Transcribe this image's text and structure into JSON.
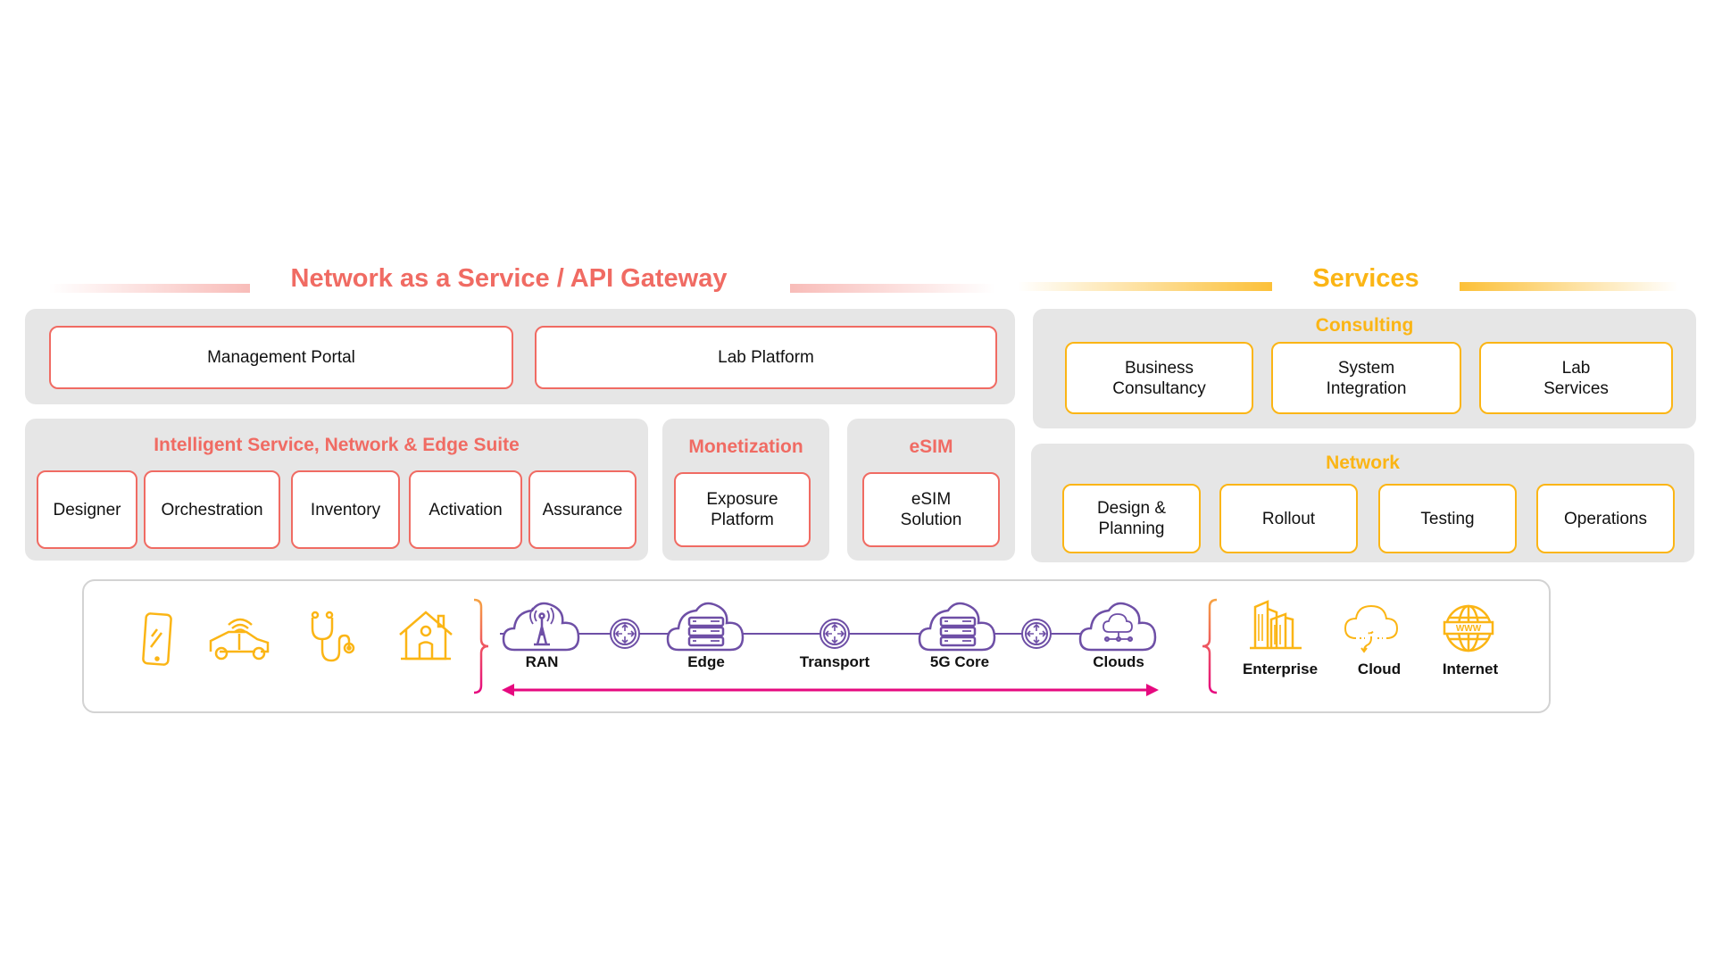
{
  "colors": {
    "red": "#f06b63",
    "yellow": "#fbb515",
    "purple": "#6e4fa6",
    "magenta": "#e6097f",
    "panel": "#e6e6e6"
  },
  "naas": {
    "title": "Network as a Service / API Gateway",
    "top_boxes": [
      "Management Portal",
      "Lab Platform"
    ],
    "isne": {
      "title": "Intelligent Service, Network & Edge Suite",
      "items": [
        "Designer",
        "Orchestration",
        "Inventory",
        "Activation",
        "Assurance"
      ]
    },
    "monetization": {
      "title": "Monetization",
      "item": "Exposure Platform"
    },
    "esim": {
      "title": "eSIM",
      "item": "eSIM Solution"
    }
  },
  "services": {
    "title": "Services",
    "consulting": {
      "title": "Consulting",
      "items": [
        "Business Consultancy",
        "System Integration",
        "Lab Services"
      ]
    },
    "network": {
      "title": "Network",
      "items": [
        "Design & Planning",
        "Rollout",
        "Testing",
        "Operations"
      ]
    }
  },
  "flow": {
    "devices": [
      {
        "icon": "smartphone-icon"
      },
      {
        "icon": "connected-car-icon"
      },
      {
        "icon": "stethoscope-icon"
      },
      {
        "icon": "smart-home-icon"
      }
    ],
    "nodes": [
      {
        "label": "RAN",
        "icon": "cell-tower-cloud-icon"
      },
      {
        "label": "Edge",
        "icon": "server-cloud-icon"
      },
      {
        "label": "Transport",
        "icon": "router-icon"
      },
      {
        "label": "5G Core",
        "icon": "server-cloud-icon"
      },
      {
        "label": "Clouds",
        "icon": "cloud-network-icon"
      }
    ],
    "destinations": [
      {
        "label": "Enterprise",
        "icon": "buildings-icon"
      },
      {
        "label": "Cloud",
        "icon": "cloud-icon"
      },
      {
        "label": "Internet",
        "icon": "globe-www-icon"
      }
    ]
  }
}
